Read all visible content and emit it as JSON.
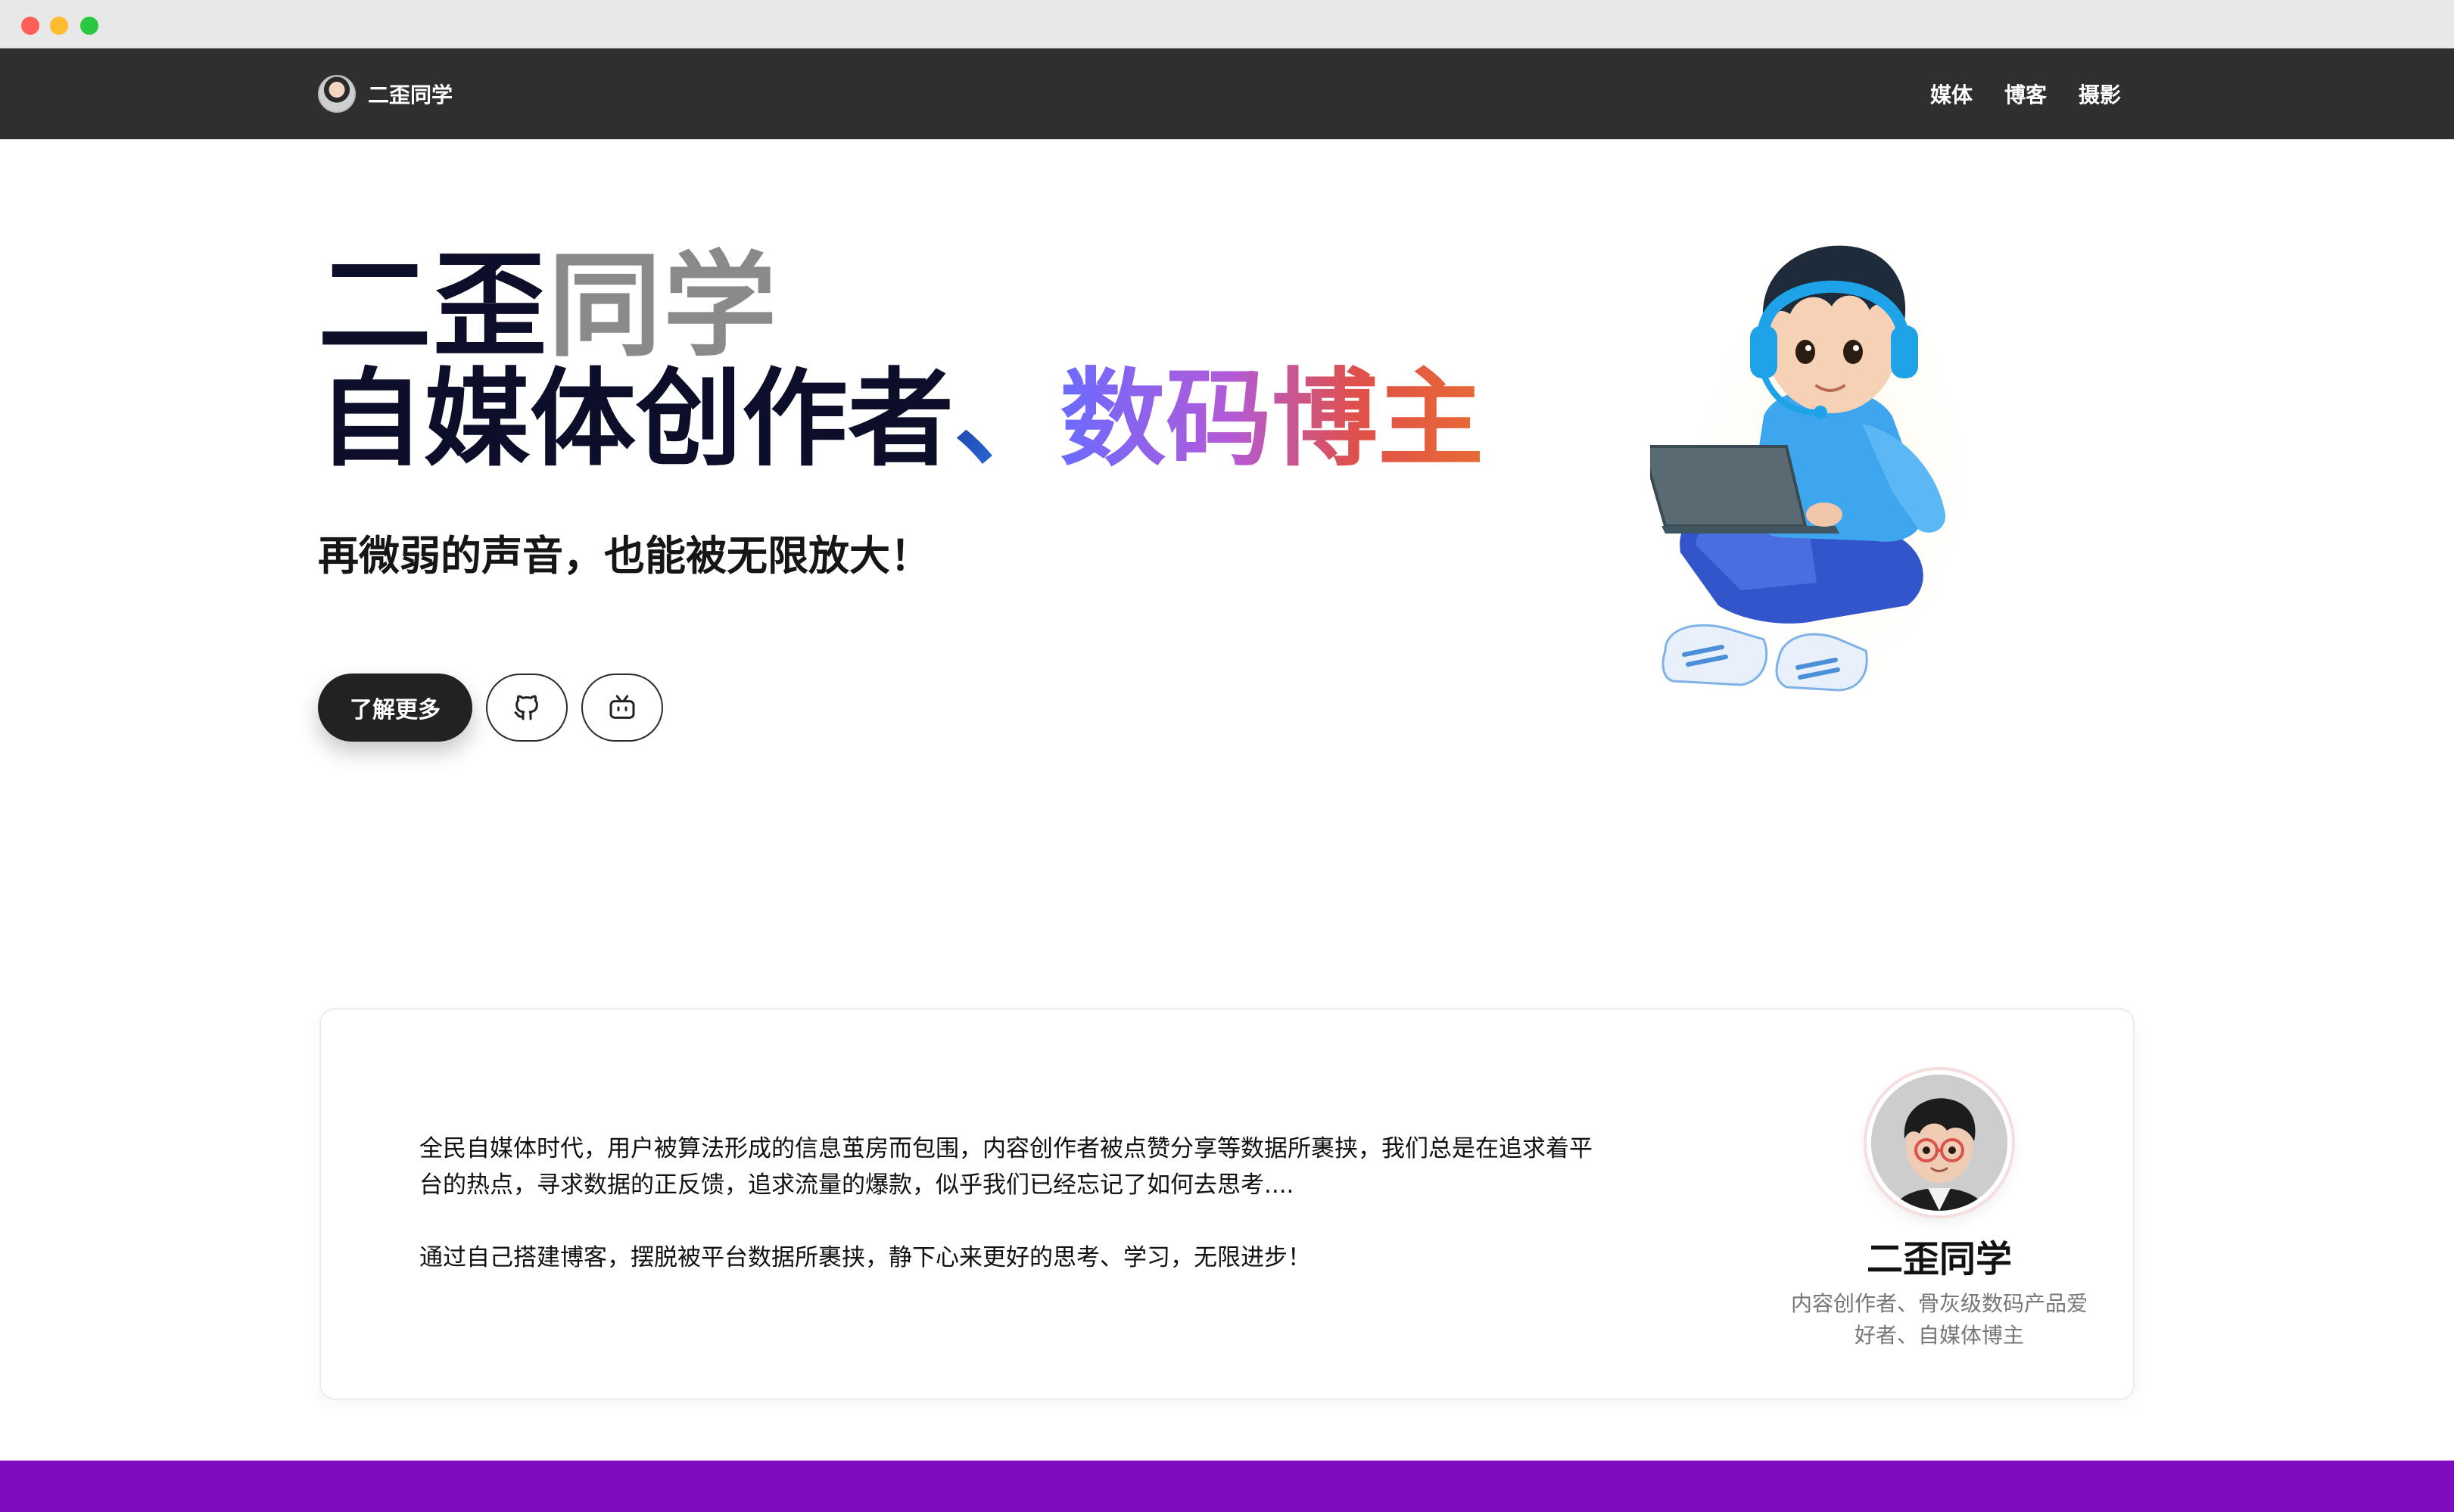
{
  "window": {
    "traffic_lights": [
      "close",
      "minimize",
      "zoom"
    ]
  },
  "navbar": {
    "brand_name": "二歪同学",
    "links": [
      {
        "label": "媒体"
      },
      {
        "label": "博客"
      },
      {
        "label": "摄影"
      }
    ],
    "background": "#2f2f2f"
  },
  "hero": {
    "name_part1": "二歪",
    "name_part2": "同学",
    "role_part1": "自媒体创作者",
    "role_separator": "、",
    "role_part2": "数码博主",
    "tagline": "再微弱的声音，也能被无限放大！",
    "primary_button": "了解更多",
    "icon_buttons": [
      "github-icon",
      "bilibili-icon"
    ]
  },
  "about": {
    "paragraph1": "全民自媒体时代，用户被算法形成的信息茧房而包围，内容创作者被点赞分享等数据所裹挟，我们总是在追求着平台的热点，寻求数据的正反馈，追求流量的爆款，似乎我们已经忘记了如何去思考....",
    "paragraph2": "通过自己搭建博客，摆脱被平台数据所裹挟，静下心来更好的思考、学习，无限进步！",
    "profile_name": "二歪同学",
    "profile_bio": "内容创作者、骨灰级数码产品爱好者、自媒体博主"
  },
  "colors": {
    "accent_gradient": [
      "#6a6bff",
      "#b35ad8",
      "#e0504a",
      "#e86a35"
    ],
    "footer": "#7f0dbf",
    "title": "#0d0f2a"
  }
}
